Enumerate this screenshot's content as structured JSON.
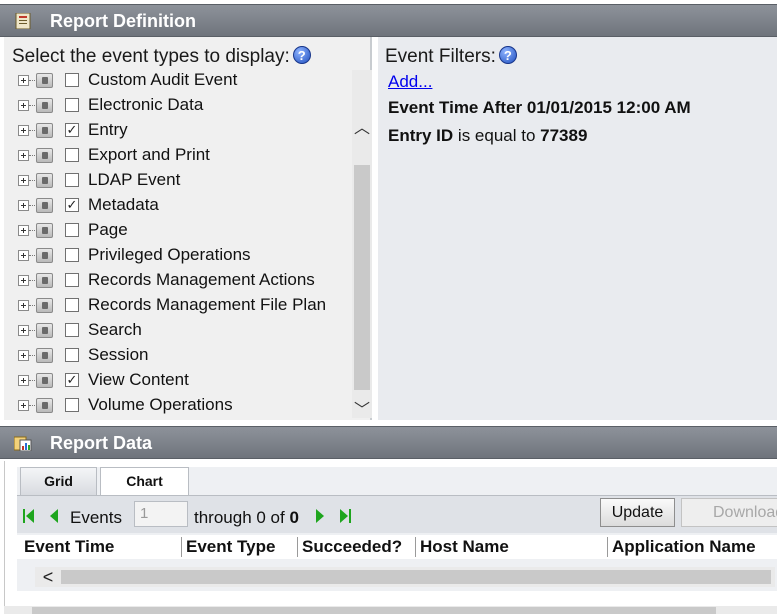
{
  "report_definition": {
    "title": "Report Definition",
    "event_types": {
      "heading": "Select the event types to display:",
      "help_glyph": "?",
      "items": [
        {
          "label": "Custom Audit Event",
          "checked": false
        },
        {
          "label": "Electronic Data",
          "checked": false
        },
        {
          "label": "Entry",
          "checked": true
        },
        {
          "label": "Export and Print",
          "checked": false
        },
        {
          "label": "LDAP Event",
          "checked": false
        },
        {
          "label": "Metadata",
          "checked": true
        },
        {
          "label": "Page",
          "checked": false
        },
        {
          "label": "Privileged Operations",
          "checked": false
        },
        {
          "label": "Records Management Actions",
          "checked": false
        },
        {
          "label": "Records Management File Plan",
          "checked": false
        },
        {
          "label": "Search",
          "checked": false
        },
        {
          "label": "Session",
          "checked": false
        },
        {
          "label": "View Content",
          "checked": true
        },
        {
          "label": "Volume Operations",
          "checked": false
        }
      ],
      "scroll_up_glyph": "︿",
      "scroll_down_glyph": "﹀"
    },
    "event_filters": {
      "heading": "Event Filters:",
      "help_glyph": "?",
      "add_link": "Add...",
      "filter_time": "Event Time After 01/01/2015 12:00 AM",
      "filter_entry_field": "Entry ID",
      "filter_entry_op": " is equal to ",
      "filter_entry_value": "77389"
    }
  },
  "report_data": {
    "title": "Report Data",
    "tabs": [
      "Grid",
      "Chart"
    ],
    "active_tab": "Chart",
    "toolbar": {
      "events_label": "Events",
      "page_value": "1",
      "through_text": "through 0 of ",
      "total": "0",
      "update_label": "Update",
      "download_label": "Download"
    },
    "columns": [
      "Event Time",
      "Event Type",
      "Succeeded?",
      "Host Name",
      "Application Name"
    ],
    "scroll_left_glyph": "<"
  },
  "colors": {
    "title_bar": "#7d828a",
    "nav_green": "#1ea51e",
    "link": "#0000ee",
    "filter_panel": "#e9ebef"
  },
  "icons": [
    "report-definition-icon",
    "report-data-icon",
    "help-icon",
    "first-page-icon",
    "prev-page-icon",
    "next-page-icon",
    "last-page-icon"
  ]
}
